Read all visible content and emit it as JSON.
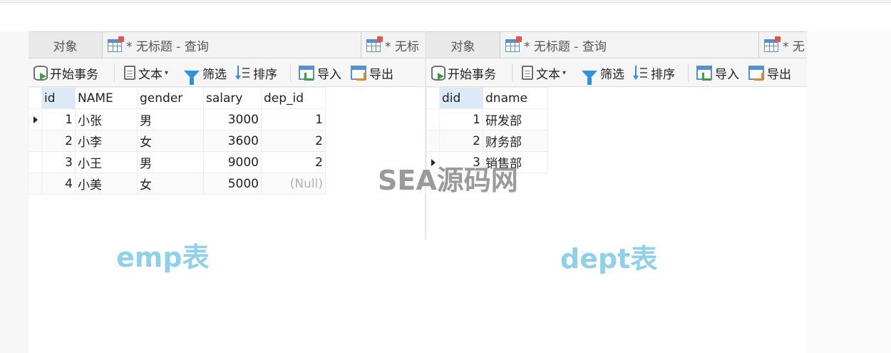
{
  "emp_pane": {
    "tabs": {
      "objects": "对象",
      "query": "* 无标题 - 查询",
      "query_partial": "* 无标"
    },
    "toolbar": {
      "begin_transaction": "开始事务",
      "text": "文本",
      "filter": "筛选",
      "sort": "排序",
      "import": "导入",
      "export": "导出"
    },
    "table": {
      "columns": [
        "id",
        "NAME",
        "gender",
        "salary",
        "dep_id"
      ],
      "rows": [
        [
          "1",
          "小张",
          "男",
          "3000",
          "1"
        ],
        [
          "2",
          "小李",
          "女",
          "3600",
          "2"
        ],
        [
          "3",
          "小王",
          "男",
          "9000",
          "2"
        ],
        [
          "4",
          "小美",
          "女",
          "5000",
          "(Null)"
        ]
      ]
    },
    "caption": "emp表"
  },
  "dept_pane": {
    "tabs": {
      "objects": "对象",
      "query": "* 无标题 - 查询",
      "query_partial": "* 无"
    },
    "toolbar": {
      "begin_transaction": "开始事务",
      "text": "文本",
      "filter": "筛选",
      "sort": "排序",
      "import": "导入",
      "export": "导出"
    },
    "table": {
      "columns": [
        "did",
        "dname"
      ],
      "rows": [
        [
          "1",
          "研发部"
        ],
        [
          "2",
          "财务部"
        ],
        [
          "3",
          "销售部"
        ]
      ]
    },
    "caption": "dept表"
  },
  "watermark": "SEA源码网",
  "colors": {
    "caption": "#8fd0ea",
    "header_selected": "#dceaf8",
    "null_text": "#b4b4b4",
    "icon_blue": "#2f8fe0",
    "icon_green": "#3aa03a"
  }
}
